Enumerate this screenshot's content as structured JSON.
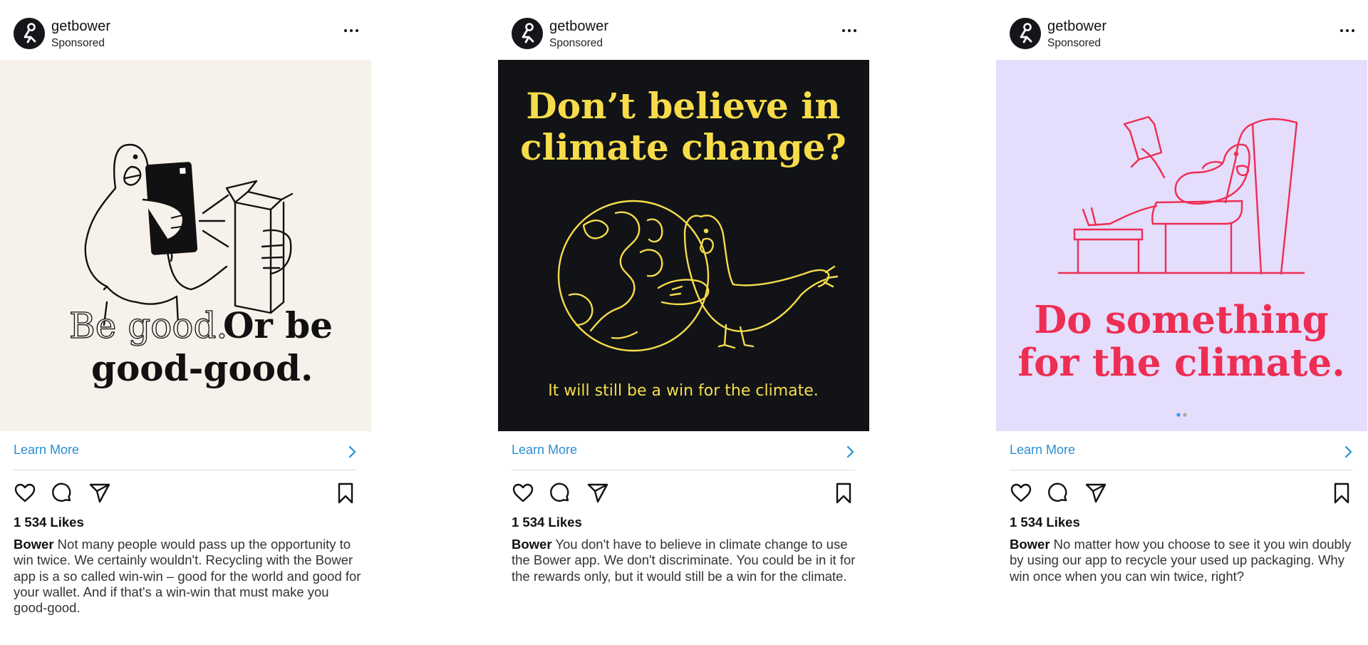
{
  "posts": [
    {
      "account": "getbower",
      "sponsored": "Sponsored",
      "media": {
        "background": "#f6f1ea",
        "headline_outlined": "Be good.",
        "headline_bold_1": "Or be",
        "headline_bold_2": "good-good.",
        "accent": "#111111"
      },
      "cta": "Learn More",
      "likes": "1 534 Likes",
      "caption_author": "Bower",
      "caption_text": " Not many people would pass up the opportunity to win twice. We certainly wouldn't. Recycling with the Bower app is a so called win-win – good for the world and good for your wallet. And if that's a win-win that must make you good-good."
    },
    {
      "account": "getbower",
      "sponsored": "Sponsored",
      "media": {
        "background": "#111317",
        "headline_1": "Don’t believe in",
        "headline_2": "climate change?",
        "subline": "It will still be a win for the climate.",
        "accent": "#f7dc4a"
      },
      "cta": "Learn More",
      "likes": "1 534 Likes",
      "caption_author": "Bower",
      "caption_text": " You don't have to believe in climate change to use the Bower app. We don't discriminate. You could be in it for the rewards only, but it would still be a win for the climate."
    },
    {
      "account": "getbower",
      "sponsored": "Sponsored",
      "media": {
        "background": "#e4ddfb",
        "headline_1": "Do something",
        "headline_2": "for the climate.",
        "accent": "#ee2d53",
        "carousel_pages": 2,
        "carousel_active": 1
      },
      "cta": "Learn More",
      "likes": "1 534 Likes",
      "caption_author": "Bower",
      "caption_text": " No matter how you choose to see it you win doubly by using our app to recycle your used up packaging. Why win once when you can win twice, right?"
    }
  ],
  "colors": {
    "link": "#2b8fd3",
    "divider": "#dbdbdb",
    "carousel_active": "#3897f0",
    "carousel_inactive": "#a8a8a8"
  },
  "icons": {
    "like": "heart-icon",
    "comment": "comment-icon",
    "share": "share-icon",
    "save": "bookmark-icon",
    "more": "more-horizontal-icon",
    "cta": "chevron-right-icon"
  }
}
